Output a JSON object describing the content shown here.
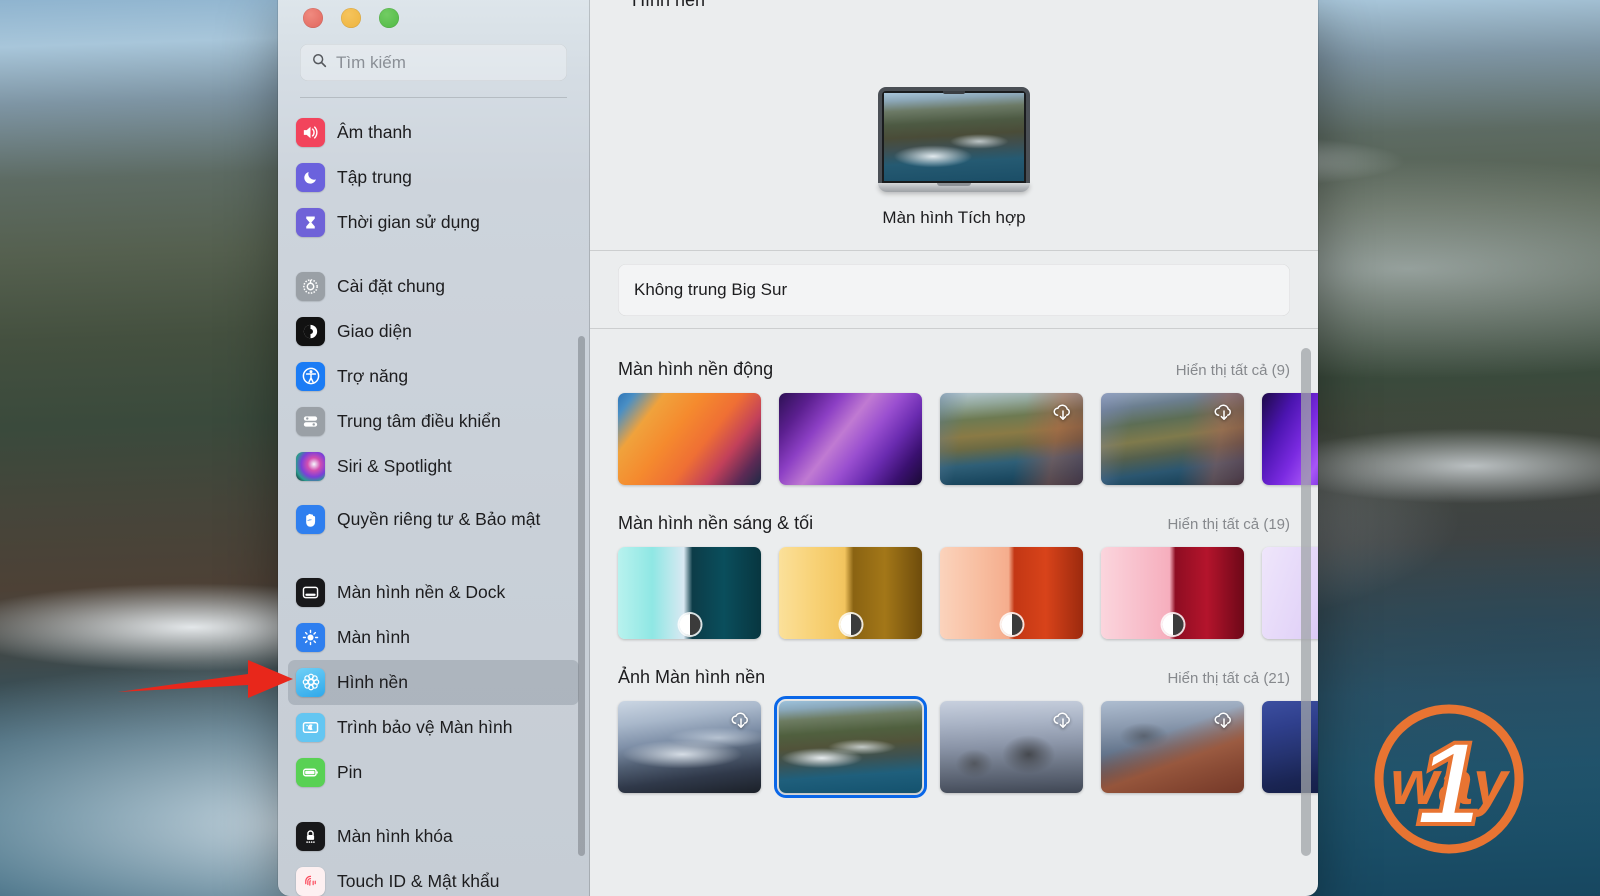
{
  "window": {
    "traffic_lights": [
      "close",
      "minimize",
      "zoom"
    ],
    "search": {
      "placeholder": "Tìm kiếm",
      "value": "",
      "icon": "search-icon"
    }
  },
  "sidebar": {
    "groups": [
      {
        "items": [
          {
            "label": "Âm thanh",
            "icon": "speaker-icon",
            "color": "#f2445c",
            "selected": false
          },
          {
            "label": "Tập trung",
            "icon": "moon-icon",
            "color": "#6b62dd",
            "selected": false
          },
          {
            "label": "Thời gian sử dụng",
            "icon": "hourglass-icon",
            "color": "#6f62d8",
            "selected": false
          }
        ]
      },
      {
        "items": [
          {
            "label": "Cài đặt chung",
            "icon": "gear-icon",
            "color": "#9aa0a6",
            "selected": false
          },
          {
            "label": "Giao diện",
            "icon": "appearance-icon",
            "color": "#111111",
            "selected": false
          },
          {
            "label": "Trợ năng",
            "icon": "accessibility-icon",
            "color": "#1b7cf5",
            "selected": false
          },
          {
            "label": "Trung tâm điều khiển",
            "icon": "control-center-icon",
            "color": "#9aa0a6",
            "selected": false
          },
          {
            "label": "Siri & Spotlight",
            "icon": "siri-icon",
            "color": "#2b2b3a",
            "selected": false
          },
          {
            "label": "Quyền riêng tư &\nBảo mật",
            "icon": "hand-icon",
            "color": "#2f7fef",
            "selected": false
          }
        ]
      },
      {
        "items": [
          {
            "label": "Màn hình nền & Dock",
            "icon": "desktop-dock-icon",
            "color": "#18181a",
            "selected": false
          },
          {
            "label": "Màn hình",
            "icon": "brightness-icon",
            "color": "#2f7fef",
            "selected": false
          },
          {
            "label": "Hình nền",
            "icon": "wallpaper-icon",
            "color": "#4ab8f0",
            "selected": true
          },
          {
            "label": "Trình bảo vệ Màn hình",
            "icon": "screensaver-icon",
            "color": "#64c6f2",
            "selected": false
          },
          {
            "label": "Pin",
            "icon": "battery-icon",
            "color": "#59d154",
            "selected": false
          }
        ]
      },
      {
        "items": [
          {
            "label": "Màn hình khóa",
            "icon": "lock-screen-icon",
            "color": "#18181a",
            "selected": false
          },
          {
            "label": "Touch ID & Mật khẩu",
            "icon": "touchid-icon",
            "color": "#fb4a5c",
            "selected": false
          }
        ]
      }
    ]
  },
  "main": {
    "pane_title": "Hình nền",
    "display_name": "Màn hình Tích hợp",
    "current_wallpaper": "Không trung Big Sur",
    "sections": [
      {
        "title": "Màn hình nền động",
        "show_all": "Hiển thị tất cả (9)",
        "count": 9,
        "thumbs": [
          {
            "art": "w-ventura-l",
            "badge": "none",
            "selected": false
          },
          {
            "art": "w-ventura-d",
            "badge": "none",
            "selected": false
          },
          {
            "art": "w-catalina",
            "badge": "cloud",
            "selected": false
          },
          {
            "art": "w-catalina2",
            "badge": "cloud",
            "selected": false
          },
          {
            "art": "w-purple",
            "badge": "none",
            "selected": false
          }
        ]
      },
      {
        "title": "Màn hình nền sáng & tối",
        "show_all": "Hiển thị tất cả (19)",
        "count": 19,
        "thumbs": [
          {
            "art": "w-blue-ld",
            "badge": "split",
            "selected": false
          },
          {
            "art": "w-gold-ld",
            "badge": "split",
            "selected": false
          },
          {
            "art": "w-orange-ld",
            "badge": "split",
            "selected": false
          },
          {
            "art": "w-pink-ld",
            "badge": "split",
            "selected": false
          },
          {
            "art": "w-violet-ld",
            "badge": "none",
            "selected": false
          }
        ]
      },
      {
        "title": "Ảnh Màn hình nền",
        "show_all": "Hiển thị tất cả (21)",
        "count": 21,
        "thumbs": [
          {
            "art": "w-fog",
            "badge": "cloud",
            "selected": false
          },
          {
            "art": "w-bigsur",
            "badge": "none",
            "selected": true
          },
          {
            "art": "w-rocks",
            "badge": "cloud",
            "selected": false
          },
          {
            "art": "w-cliff",
            "badge": "cloud",
            "selected": false
          },
          {
            "art": "w-night",
            "badge": "none",
            "selected": false
          }
        ]
      }
    ]
  },
  "annotations": {
    "arrow": {
      "color": "#e8271b",
      "points_to": "Hình nền"
    },
    "watermark": {
      "text": "way",
      "digit": "1",
      "color": "#e87432"
    }
  }
}
